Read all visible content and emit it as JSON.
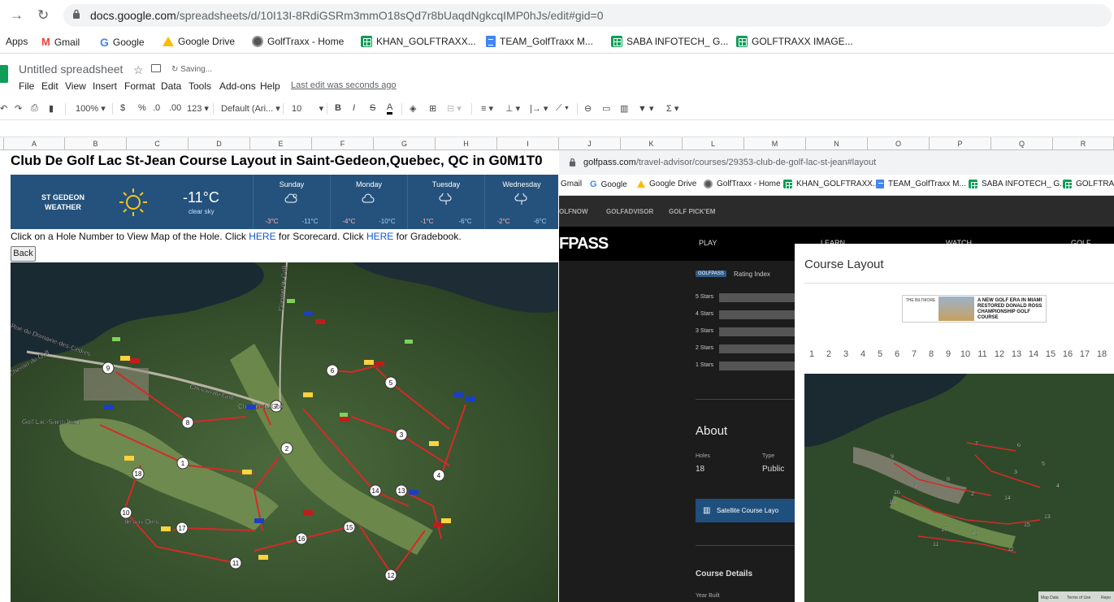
{
  "browser": {
    "url_host": "docs.google.com",
    "url_path": "/spreadsheets/d/10I13I-8RdiGSRm3mmO18sQd7r8bUaqdNgkcqIMP0hJs/edit#gid=0",
    "bookmarks": [
      "Apps",
      "Gmail",
      "Google",
      "Google Drive",
      "GolfTraxx - Home",
      "KHAN_GOLFTRAXX...",
      "TEAM_GolfTraxx M...",
      "SABA INFOTECH_ G...",
      "GOLFTRAXX IMAGE..."
    ]
  },
  "sheets": {
    "title": "Untitled spreadsheet",
    "saving": "Saving...",
    "menu": [
      "File",
      "Edit",
      "View",
      "Insert",
      "Format",
      "Data",
      "Tools",
      "Add-ons",
      "Help"
    ],
    "last_edit": "Last edit was seconds ago",
    "toolbar": {
      "zoom": "100%",
      "currency": "$",
      "percent": "%",
      "dec_dec": ".0",
      "inc_dec": ".00",
      "format_more": "123",
      "font": "Default (Ari...",
      "size": "10",
      "bold": "B",
      "italic": "I",
      "strike": "S",
      "text_color": "A",
      "sum": "Σ"
    },
    "columns": [
      "A",
      "B",
      "C",
      "D",
      "E",
      "F",
      "G",
      "H",
      "I",
      "J",
      "K",
      "L",
      "M",
      "N",
      "O",
      "P",
      "Q",
      "R"
    ]
  },
  "page": {
    "title": "Club De Golf Lac St-Jean Course Layout in Saint-Gedeon,Quebec, QC in G0M1T0",
    "instructions": {
      "part1": "Click on a Hole Number to View Map of the Hole. Click ",
      "link1": "HERE",
      "part2": " for Scorecard. Click ",
      "link2": "HERE",
      "part3": " for Gradebook."
    },
    "back_button": "Back"
  },
  "weather": {
    "location_line1": "ST GEDEON",
    "location_line2": "WEATHER",
    "temperature": "-11°C",
    "condition": "clear sky",
    "days": [
      {
        "name": "Sunday",
        "high": "-3°C",
        "low": "-11°C",
        "icon": "partly-cloudy-snow-icon"
      },
      {
        "name": "Monday",
        "high": "-4°C",
        "low": "-10°C",
        "icon": "cloud-icon"
      },
      {
        "name": "Tuesday",
        "high": "-1°C",
        "low": "-6°C",
        "icon": "snow-cloud-icon"
      },
      {
        "name": "Wednesday",
        "high": "-2°C",
        "low": "-6°C",
        "icon": "snow-cloud-icon"
      }
    ]
  },
  "map_left": {
    "labels": [
      "Golf Lac-Saint-Jean",
      "Chemin du Golf",
      "Chemin du Golf",
      "Chemin du Golf",
      "Rue du Domaine-des-Cèdres",
      "Chemin du Golf",
      "Île aux Oies"
    ],
    "holes": [
      "1",
      "2",
      "3",
      "4",
      "5",
      "6",
      "7",
      "8",
      "9",
      "10",
      "11",
      "12",
      "13",
      "14",
      "15",
      "16",
      "17",
      "18"
    ]
  },
  "embedded": {
    "url_host": "golfpass.com",
    "url_path": "/travel-advisor/courses/29353-club-de-golf-lac-st-jean#layout",
    "bookmarks": [
      "Gmail",
      "Google",
      "Google Drive",
      "GolfTraxx - Home",
      "KHAN_GOLFTRAXX...",
      "TEAM_GolfTraxx M...",
      "SABA INFOTECH_ G...",
      "GOLFTRAXX"
    ],
    "nav1": [
      "OLFNOW",
      "GOLFADVISOR",
      "GOLF PICK'EM"
    ],
    "brand": "FPASS",
    "nav2": [
      "PLAY",
      "LEARN",
      "WATCH",
      "GOLF ADVISO"
    ],
    "rating_badge": "GOLFPASS",
    "rating_index": "Rating Index",
    "stars": [
      "5 Stars",
      "4 Stars",
      "3 Stars",
      "2 Stars",
      "1 Stars"
    ],
    "about": "About",
    "holes_label": "Holes",
    "holes_value": "18",
    "type_label": "Type",
    "type_value": "Public",
    "satellite_button": "Satellite Course Layo",
    "course_details": "Course Details",
    "year_built": "Year Built"
  },
  "modal": {
    "title": "Course Layout",
    "ad_logo": "THE BILTMORE",
    "ad_text": "A NEW GOLF ERA IN MIAMI RESTORED DONALD ROSS CHAMPIONSHIP GOLF COURSE",
    "holes": [
      "1",
      "2",
      "3",
      "4",
      "5",
      "6",
      "7",
      "8",
      "9",
      "10",
      "11",
      "12",
      "13",
      "14",
      "15",
      "16",
      "17",
      "18"
    ],
    "map_footer": [
      "Map Data",
      "Terms of Use",
      "Repo"
    ]
  }
}
